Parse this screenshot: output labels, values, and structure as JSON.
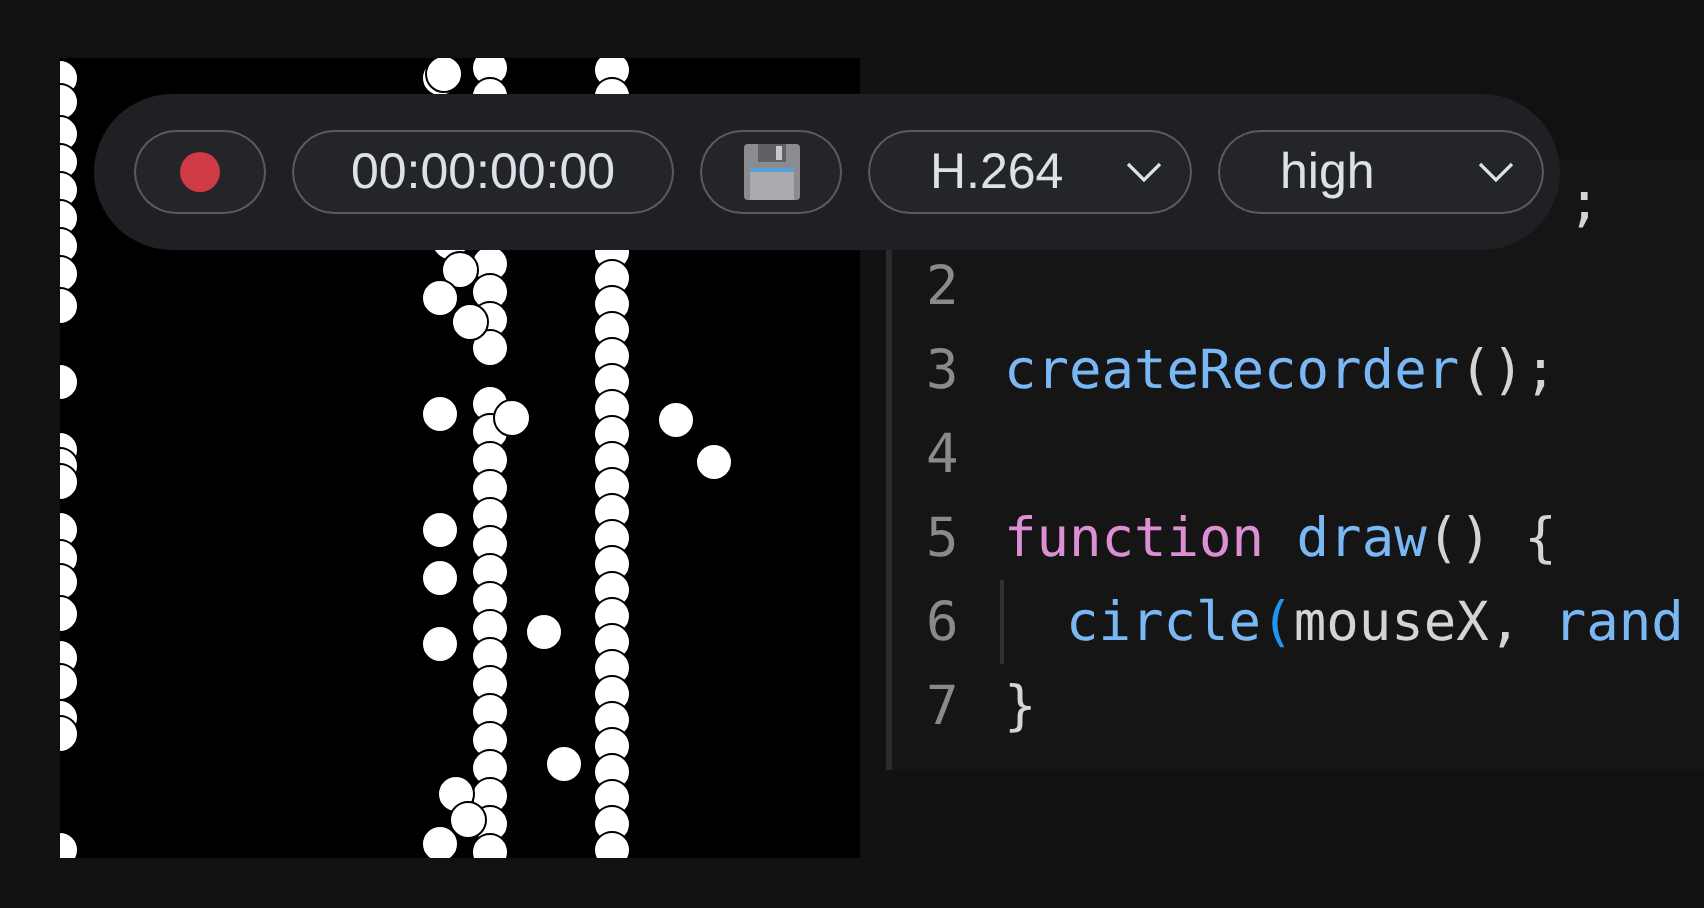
{
  "toolbar": {
    "timecode": "00:00:00:00",
    "codec": "H.264",
    "quality": "high"
  },
  "editor": {
    "lines": [
      {
        "indent": false,
        "tokens": [
          {
            "text": ";",
            "kind": "punct"
          }
        ]
      },
      {
        "number": "2",
        "indent": false
      },
      {
        "number": "3",
        "indent": false,
        "tokens": [
          {
            "text": "createRecorder",
            "kind": "function"
          },
          {
            "text": "();",
            "kind": "punct"
          }
        ]
      },
      {
        "number": "4",
        "indent": false
      },
      {
        "number": "5",
        "indent": false,
        "tokens": [
          {
            "text": "function",
            "kind": "keyword"
          },
          {
            "text": " draw",
            "kind": "function"
          },
          {
            "text": "() {",
            "kind": "punct"
          }
        ]
      },
      {
        "number": "6",
        "indent": true,
        "tokens": [
          {
            "text": "circle",
            "kind": "function"
          },
          {
            "text": "(",
            "kind": "bracket-match"
          },
          {
            "text": "mouseX, ",
            "kind": "plain"
          },
          {
            "text": "rand",
            "kind": "function"
          }
        ]
      },
      {
        "number": "7",
        "indent": false,
        "tokens": [
          {
            "text": "}",
            "kind": "punct"
          }
        ]
      }
    ]
  }
}
